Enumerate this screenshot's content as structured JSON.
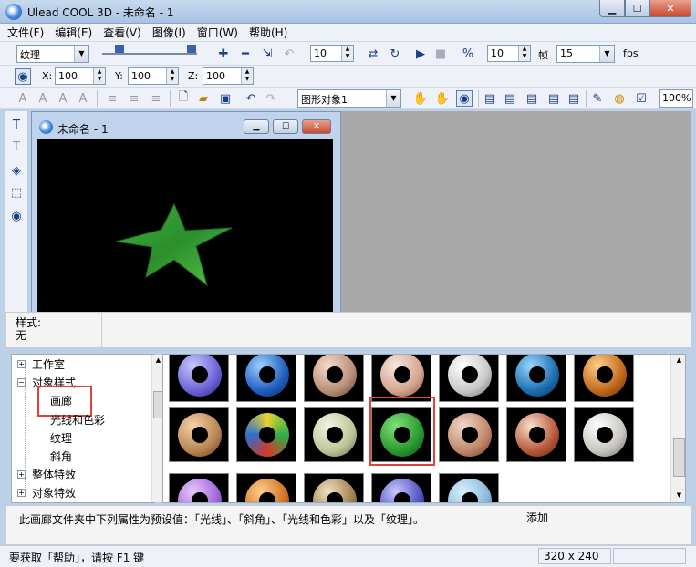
{
  "window": {
    "title": "Ulead COOL 3D - 未命名 - 1"
  },
  "menu": [
    "文件(F)",
    "编辑(E)",
    "查看(V)",
    "图像(I)",
    "窗口(W)",
    "帮助(H)"
  ],
  "toolbar1": {
    "style_combo": "纹理",
    "spin1": "10",
    "spin2": "10",
    "frame_label": "帧",
    "fps_value": "15",
    "fps_label": "fps"
  },
  "toolbar2": {
    "x_label": "X:",
    "x_value": "100",
    "y_label": "Y:",
    "y_value": "100",
    "z_label": "Z:",
    "z_value": "100"
  },
  "toolbar3": {
    "object_combo": "图形对象1",
    "zoom": "100%"
  },
  "doc": {
    "title": "未命名 - 1"
  },
  "style_panel": {
    "label": "样式:",
    "value": "无"
  },
  "tree": {
    "items": [
      {
        "label": "工作室",
        "expander": "+"
      },
      {
        "label": "对象样式",
        "expander": "−"
      },
      {
        "label": "画廊"
      },
      {
        "label": "光线和色彩"
      },
      {
        "label": "纹理"
      },
      {
        "label": "斜角"
      },
      {
        "label": "整体特效",
        "expander": "+"
      },
      {
        "label": "对象特效",
        "expander": "+"
      }
    ]
  },
  "description": {
    "text": "此画廊文件夹中下列属性为预设值：「光线」、「斜角」、「光线和色彩」以及「纹理」。",
    "add_label": "添加"
  },
  "status": {
    "help_text": "要获取「帮助」，请按 F1 键",
    "size": "320 x 240"
  }
}
